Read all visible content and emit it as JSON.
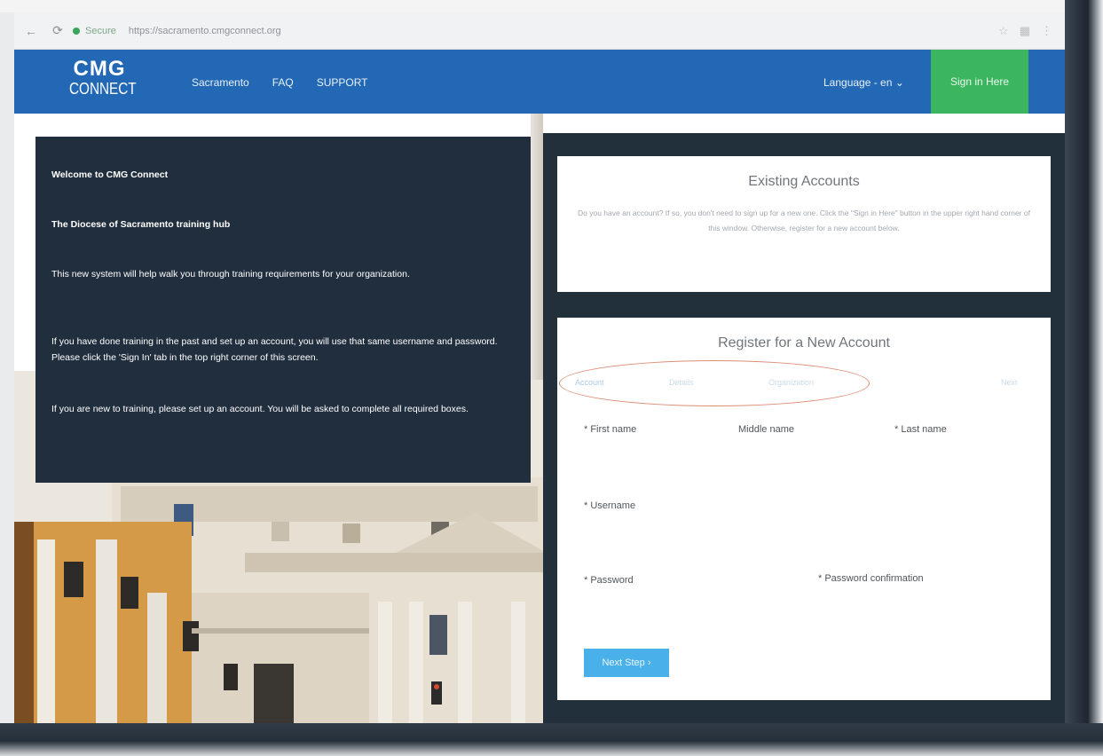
{
  "browser": {
    "secure_label": "Secure",
    "url": "https://sacramento.cmgconnect.org"
  },
  "header": {
    "logo_top": "CMG",
    "logo_bottom": "CONNECT",
    "nav": [
      "Sacramento",
      "FAQ",
      "SUPPORT"
    ],
    "language": "Language - en ⌄",
    "sign_in": "Sign in Here"
  },
  "welcome": {
    "lines": [
      "Welcome to CMG Connect",
      "The Diocese of Sacramento training hub",
      "This new system will help walk you through training requirements for your organization.",
      "If you have done training in the past and set up an account, you will use that same username and password. Please click the 'Sign In' tab in the top right corner of this screen.",
      "If you are new to training, please set up an account. You will be asked to complete all required boxes."
    ]
  },
  "existing": {
    "title": "Existing Accounts",
    "text": "Do you have an account? If so, you don't need to sign up for a new one. Click the \"Sign in Here\" button in the upper right hand corner of this window. Otherwise, register for a new account below."
  },
  "register": {
    "title": "Register for a New Account",
    "steps": [
      "Account",
      "Details",
      "Organization"
    ],
    "step_right": "Next",
    "fields": {
      "first_name": "* First name",
      "middle_name": "Middle name",
      "last_name": "* Last name",
      "username": "* Username",
      "password": "* Password",
      "password_confirmation": "* Password confirmation"
    },
    "next_button": "Next Step ›"
  },
  "colors": {
    "header_blue": "#2268b4",
    "signin_green": "#3bb55e",
    "welcome_panel": "#202e3e",
    "button_blue": "#4ab0ea",
    "annotation_oval": "#dd8d75"
  }
}
